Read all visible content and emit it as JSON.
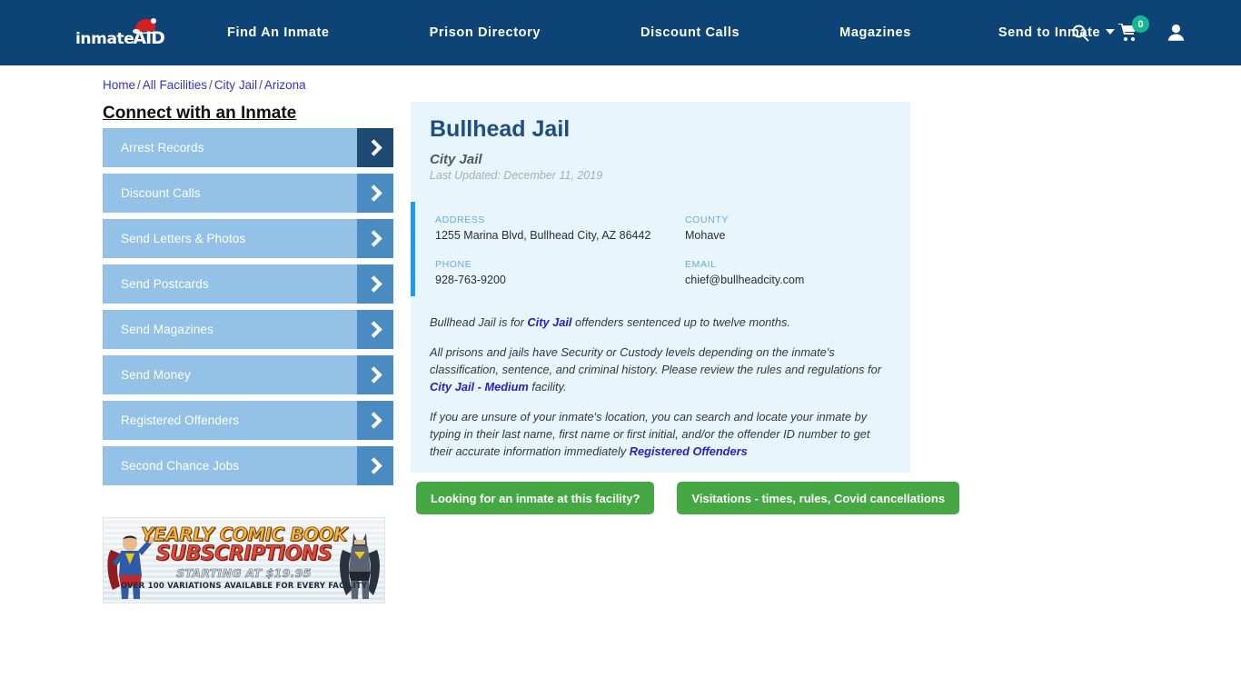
{
  "header": {
    "logo_text": "inmate",
    "logo_accent": "AID",
    "nav": [
      {
        "label": "Find An Inmate",
        "name": "nav-find-an-inmate"
      },
      {
        "label": "Prison Directory",
        "name": "nav-prison-directory"
      },
      {
        "label": "Discount Calls",
        "name": "nav-discount-calls"
      },
      {
        "label": "Magazines",
        "name": "nav-magazines"
      },
      {
        "label": "Send to Inmate",
        "name": "nav-send-to-inmate",
        "has_caret": true
      }
    ],
    "cart_count": "0",
    "bg_color": "#0d4375",
    "badge_color": "#12b892"
  },
  "breadcrumb": {
    "items": [
      "Home",
      "All Facilities",
      "City Jail",
      "Arizona"
    ],
    "separator": "/"
  },
  "sidebar": {
    "title": "Connect with an Inmate",
    "items": [
      {
        "label": "Arrest Records",
        "active": true
      },
      {
        "label": "Discount Calls",
        "active": false
      },
      {
        "label": "Send Letters & Photos",
        "active": false
      },
      {
        "label": "Send Postcards",
        "active": false
      },
      {
        "label": "Send Magazines",
        "active": false
      },
      {
        "label": "Send Money",
        "active": false
      },
      {
        "label": "Registered Offenders",
        "active": false
      },
      {
        "label": "Second Chance Jobs",
        "active": false
      }
    ]
  },
  "banner_ad": {
    "line1": "YEARLY COMIC BOOK",
    "line2": "SUBSCRIPTIONS",
    "line3": "STARTING AT $19.95",
    "line4": "OVER 100 VARIATIONS AVAILABLE FOR EVERY FACILITY"
  },
  "facility": {
    "title": "Bullhead Jail",
    "subtitle": "City Jail",
    "last_updated": "Last Updated: December 11, 2019",
    "info": [
      {
        "key": "ADDRESS",
        "value": "1255 Marina Blvd, Bullhead City, AZ 86442"
      },
      {
        "key": "COUNTY",
        "value": "Mohave"
      },
      {
        "key": "PHONE",
        "value": "928-763-9200"
      },
      {
        "key": "EMAIL",
        "value": "chief@bullheadcity.com"
      }
    ],
    "paragraphs": {
      "p1_a": "Bullhead Jail is for ",
      "p1_link": "City Jail",
      "p1_b": " offenders sentenced up to twelve months.",
      "p2_a": "All prisons and jails have Security or Custody levels depending on the inmate's classification, sentence, and criminal history. Please review the rules and regulations for ",
      "p2_link": "City Jail - Medium",
      "p2_b": " facility.",
      "p3_a": "If you are unsure of your inmate's location, you can search and locate your inmate by typing in their last name, first name or first initial, and/or the offender ID number to get their accurate information immediately ",
      "p3_link": "Registered Offenders"
    },
    "accent_color": "#1e9af0",
    "card_bg": "#e8f5fd"
  },
  "actions": {
    "inmate_search_label": "Looking for an inmate at this facility?",
    "visitation_label": "Visitations - times, rules, Covid cancellations",
    "button_color": "#45a845"
  }
}
